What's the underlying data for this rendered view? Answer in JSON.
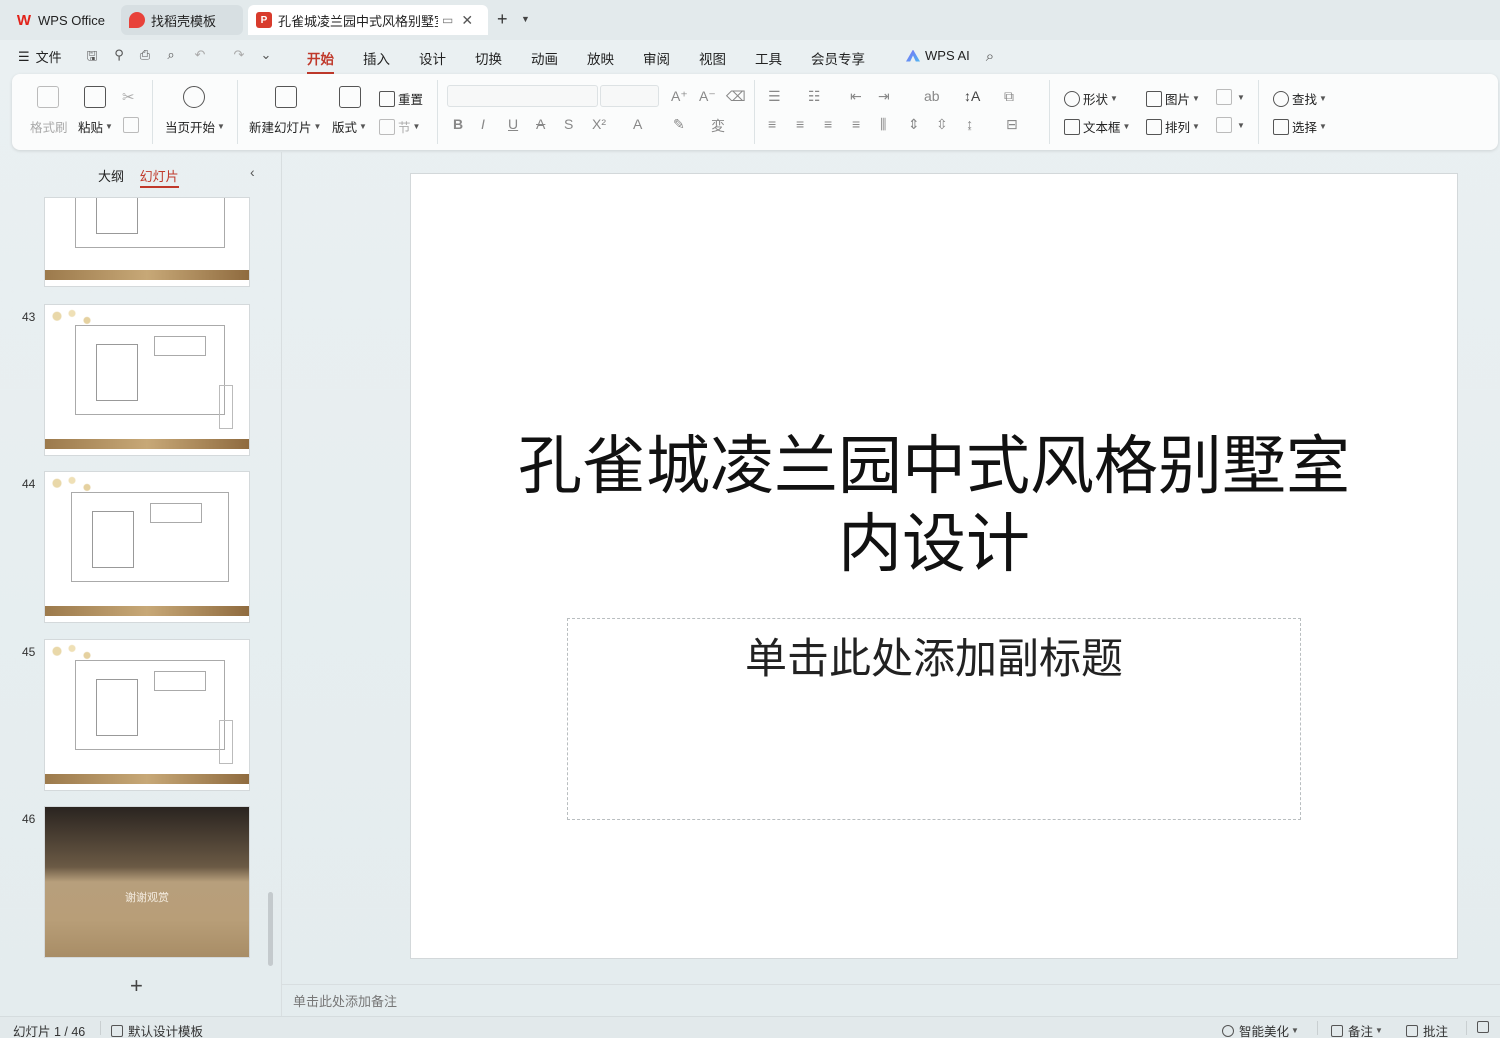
{
  "tabs": [
    {
      "label": "WPS Office"
    },
    {
      "label": "找稻壳模板"
    },
    {
      "label": "孔雀城凌兰园中式风格别墅室内设计"
    }
  ],
  "menu": {
    "file": "文件",
    "items": [
      "开始",
      "插入",
      "设计",
      "切换",
      "动画",
      "放映",
      "审阅",
      "视图",
      "工具",
      "会员专享"
    ],
    "active_index": 0,
    "ai": "WPS AI"
  },
  "ribbon": {
    "format_painter": "格式刷",
    "paste": "粘贴",
    "start_from_current": "当页开始",
    "new_slide": "新建幻灯片",
    "layout": "版式",
    "reset": "重置",
    "section": "节",
    "shape": "形状",
    "picture": "图片",
    "find": "查找",
    "textbox": "文本框",
    "arrange": "排列",
    "select": "选择"
  },
  "panel": {
    "outline_tab": "大纲",
    "slides_tab": "幻灯片",
    "slide_numbers": [
      "43",
      "44",
      "45",
      "46"
    ],
    "last_slide_text": "谢谢观赏"
  },
  "slide": {
    "title": "孔雀城凌兰园中式风格别墅室内设计",
    "subtitle_placeholder": "单击此处添加副标题"
  },
  "notes_placeholder": "单击此处添加备注",
  "status": {
    "slide_indicator": "幻灯片 1 / 46",
    "template": "默认设计模板",
    "beautify": "智能美化",
    "notes": "备注",
    "comments": "批注"
  }
}
